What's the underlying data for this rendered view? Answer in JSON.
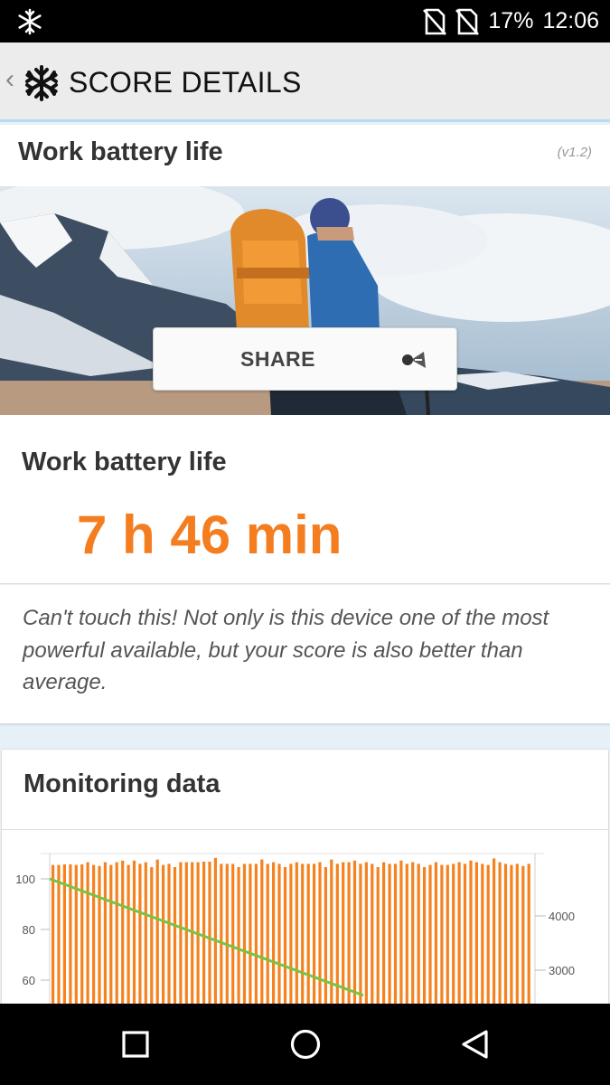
{
  "status_bar": {
    "battery": "17%",
    "time": "12:06",
    "left_icon": "snowflake-icon",
    "sim_icons": [
      "no-sim-icon",
      "no-sim-icon"
    ]
  },
  "app_bar": {
    "back_icon": "chevron-left-icon",
    "logo_icon": "snowflake-icon",
    "title": "SCORE DETAILS"
  },
  "header": {
    "title": "Work battery life",
    "version": "(v1.2)"
  },
  "hero": {
    "share_label": "SHARE",
    "share_icon": "share-icon"
  },
  "result": {
    "label": "Work battery life",
    "value": "7 h 46 min",
    "value_color": "#f47d20"
  },
  "description": "Can't touch this! Not only is this device one of the most powerful available, but your score is also better than average.",
  "monitoring": {
    "title": "Monitoring data",
    "chart_data": {
      "type": "bar",
      "left_axis_ticks": [
        "100",
        "80",
        "60"
      ],
      "right_axis_ticks": [
        "4000",
        "3000"
      ],
      "series": [
        {
          "axis": "right",
          "color": "#f5821f",
          "values": [
            4940,
            4940,
            4950,
            4950,
            4940,
            4950,
            4990,
            4940,
            4920,
            4990,
            4940,
            4990,
            5020,
            4940,
            5020,
            4960,
            4990,
            4900,
            5040,
            4940,
            4960,
            4900,
            4990,
            4990,
            4990,
            4990,
            5000,
            5000,
            5070,
            4960,
            4960,
            4960,
            4900,
            4960,
            4960,
            4960,
            5040,
            4960,
            4990,
            4960,
            4900,
            4960,
            4990,
            4960,
            4960,
            4960,
            4990,
            4900,
            5040,
            4960,
            4990,
            4990,
            5020,
            4960,
            4990,
            4960,
            4900,
            4990,
            4960,
            4960,
            5020,
            4960,
            4990,
            4960,
            4900,
            4940,
            4990,
            4940,
            4940,
            4960,
            4990,
            4960,
            5020,
            4990,
            4960,
            4940,
            5060,
            4990,
            4960,
            4940,
            4960,
            4920,
            4960
          ]
        },
        {
          "axis": "left",
          "color": "#7cc242",
          "values": [
            100,
            54
          ]
        }
      ],
      "left_ylim": [
        54,
        105
      ],
      "right_ylim": [
        2300,
        5200
      ],
      "grid": true
    }
  },
  "nav_bar": {
    "buttons": [
      "recents-icon",
      "home-icon",
      "back-icon"
    ]
  }
}
